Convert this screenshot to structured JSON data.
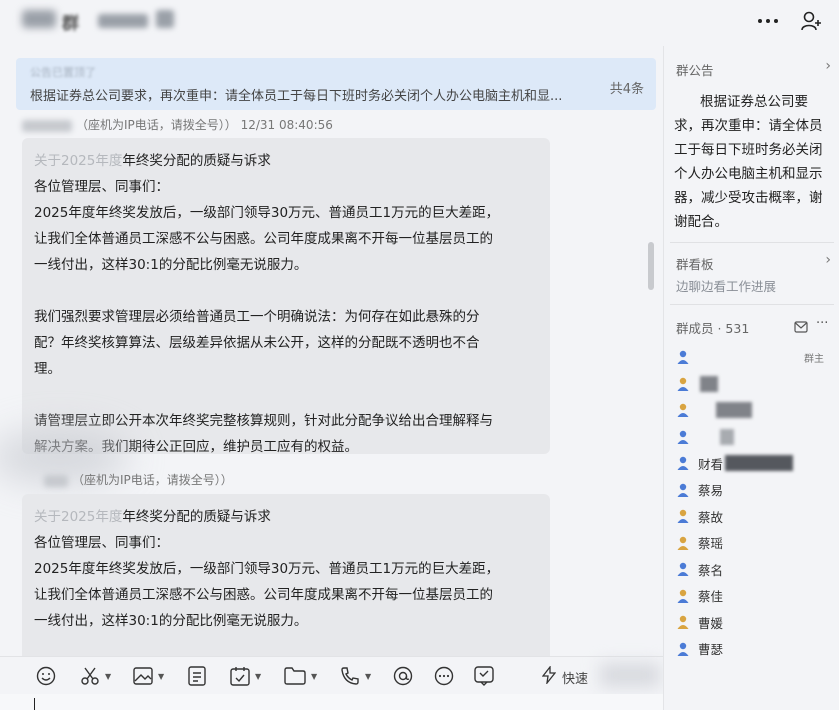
{
  "header": {
    "title": "群",
    "more_icon": "more-dots-icon",
    "add_member_icon": "add-member-icon"
  },
  "pinned": {
    "sub": "公告已置顶了",
    "text": "根据证券总公司要求，再次重申：请全体员工于每日下班时务必关闭个人办公电脑主机和显...",
    "count": "共4条"
  },
  "messages": [
    {
      "sender_meta": "（座机为IP电话，请拨全号）） 12/31 08:40:56",
      "title_dim": "关于2025年度",
      "title_rest": "年终奖分配的质疑与诉求",
      "lines": [
        "各位管理层、同事们：",
        "2025年度年终奖发放后，一级部门领导30万元、普通员工1万元的巨大差距，",
        "让我们全体普通员工深感不公与困惑。公司年度成果离不开每一位基层员工的",
        "一线付出，这样30:1的分配比例毫无说服力。",
        "",
        "我们强烈要求管理层必须给普通员工一个明确说法：为何存在如此悬殊的分",
        "配？年终奖核算算法、层级差异依据从未公开，这样的分配既不透明也不合",
        "理。",
        "",
        "请管理层立即公开本次年终奖完整核算规则，针对此分配争议给出合理解释与",
        "解决方案。我们期待公正回应，维护员工应有的权益。"
      ]
    },
    {
      "sender_meta": "（座机为IP电话，请拨全号））",
      "title_dim": "关于2025年度",
      "title_rest": "年终奖分配的质疑与诉求",
      "lines": [
        "各位管理层、同事们：",
        "2025年度年终奖发放后，一级部门领导30万元、普通员工1万元的巨大差距，",
        "让我们全体普通员工深感不公与困惑。公司年度成果离不开每一位基层员工的",
        "一线付出，这样30:1的分配比例毫无说服力。"
      ]
    }
  ],
  "toolbar": {
    "items": [
      "emoji-icon",
      "scissors-icon",
      "image-icon",
      "document-icon",
      "calendar-icon",
      "folder-icon",
      "phone-icon",
      "at-icon",
      "chat-more-icon",
      "message-icon"
    ],
    "quick_label": "快速"
  },
  "right_panel": {
    "notice_title": "群公告",
    "notice_text": "根据证券总公司要求，再次重申：请全体员工于每日下班时务必关闭个人办公电脑主机和显示器，减少受攻击概率，谢谢配合。",
    "board_title": "群看板",
    "board_text": "边聊边看工作进展",
    "members_title": "群成员 · 531",
    "owner_tag": "群主",
    "members": [
      "",
      "",
      "",
      "",
      "",
      "财看",
      "蔡易",
      "蔡故",
      "蔡瑶",
      "蔡名",
      "蔡佳",
      "曹媛",
      "曹瑟"
    ]
  }
}
